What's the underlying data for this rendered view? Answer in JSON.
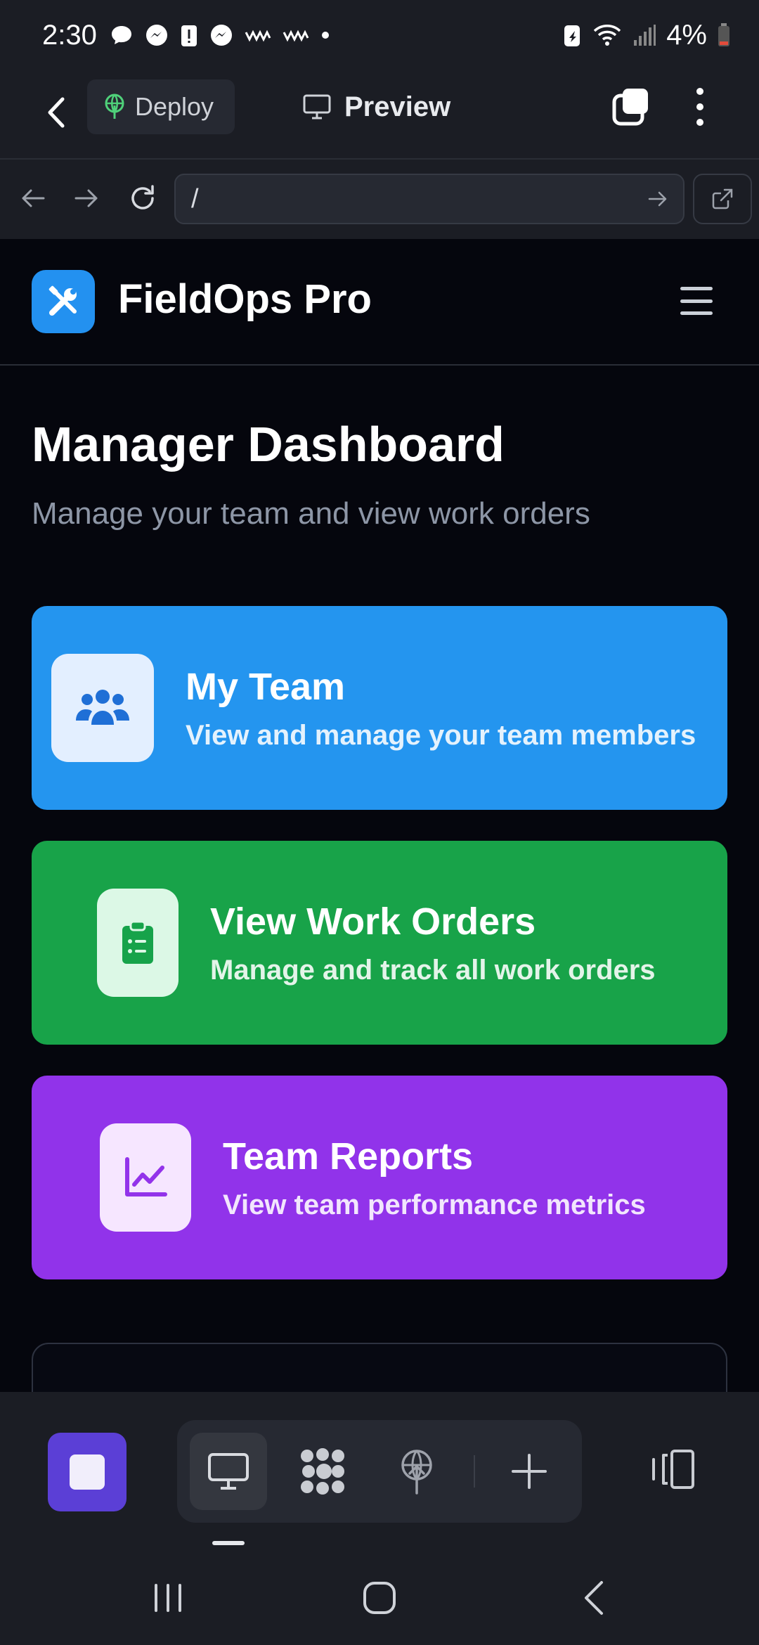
{
  "status_bar": {
    "time": "2:30",
    "battery_percent": "4%"
  },
  "app_bar": {
    "deploy_label": "Deploy",
    "preview_label": "Preview"
  },
  "browser": {
    "url": "/"
  },
  "site": {
    "brand": "FieldOps Pro",
    "page_title": "Manager Dashboard",
    "page_subtitle": "Manage your team and view work orders",
    "cards": [
      {
        "title": "My Team",
        "description": "View and manage your team members",
        "color": "#2495ef",
        "icon": "users-icon"
      },
      {
        "title": "View Work Orders",
        "description": "Manage and track all work orders",
        "color": "#18a349",
        "icon": "clipboard-list-icon"
      },
      {
        "title": "Team Reports",
        "description": "View team performance metrics",
        "color": "#9133ea",
        "icon": "chart-line-icon"
      }
    ]
  },
  "colors": {
    "accent_purple": "#5b3fd6",
    "logo_blue": "#2391f0"
  }
}
